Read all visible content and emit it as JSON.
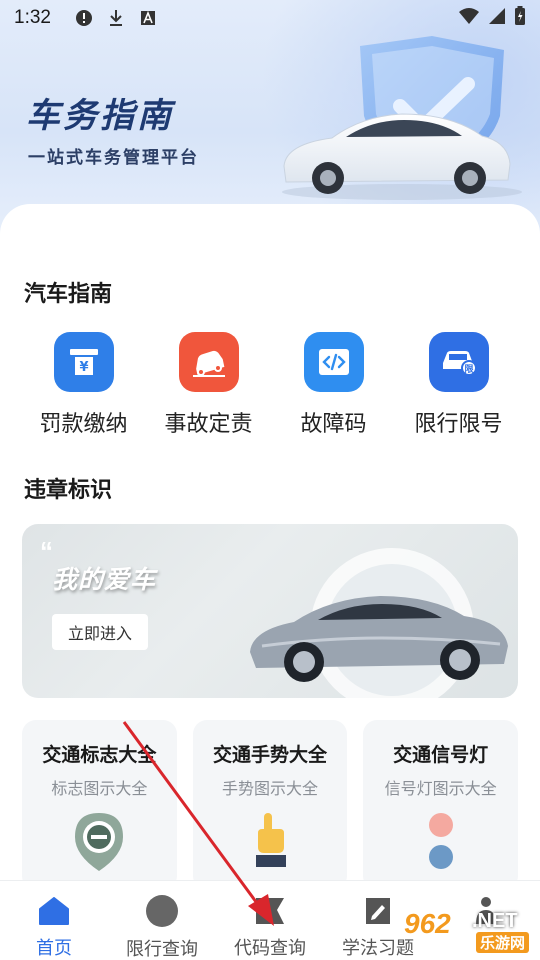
{
  "status_bar": {
    "time": "1:32",
    "left_icons": [
      "alert-icon",
      "download-icon",
      "a-icon"
    ],
    "right_icons": [
      "wifi-icon",
      "signal-icon",
      "battery-icon"
    ]
  },
  "header": {
    "title": "车务指南",
    "subtitle": "一站式车务管理平台"
  },
  "car_guide": {
    "title": "汽车指南",
    "tools": [
      {
        "label": "罚款缴纳",
        "icon": "fine-payment-icon",
        "color": "#2f7fe8"
      },
      {
        "label": "事故定责",
        "icon": "accident-icon",
        "color": "#f0563c"
      },
      {
        "label": "故障码",
        "icon": "code-icon",
        "color": "#2f8ef0"
      },
      {
        "label": "限行限号",
        "icon": "restricted-car-icon",
        "color": "#2f6fe4"
      }
    ]
  },
  "violation_signs": {
    "title": "违章标识"
  },
  "banner": {
    "title": "我的爱车",
    "button": "立即进入"
  },
  "cards": [
    {
      "title": "交通标志大全",
      "subtitle": "标志图示大全",
      "icon": "traffic-sign-icon"
    },
    {
      "title": "交通手势大全",
      "subtitle": "手势图示大全",
      "icon": "hand-gesture-icon"
    },
    {
      "title": "交通信号灯",
      "subtitle": "信号灯图示大全",
      "icon": "traffic-light-icon"
    }
  ],
  "tabbar": [
    {
      "label": "首页",
      "icon": "home-icon",
      "active": true
    },
    {
      "label": "限行查询",
      "icon": "circle-icon",
      "active": false
    },
    {
      "label": "代码查询",
      "icon": "flag-icon",
      "active": false
    },
    {
      "label": "学法习题",
      "icon": "edit-icon",
      "active": false
    },
    {
      "label": "",
      "icon": "profile-icon",
      "active": false
    }
  ],
  "watermark": {
    "number": "962",
    "suffix": ".NET",
    "text": "乐游网"
  },
  "colors": {
    "accent": "#2f6fe4",
    "title_dark": "#1e3a72",
    "annotation_arrow": "#d9262c"
  }
}
